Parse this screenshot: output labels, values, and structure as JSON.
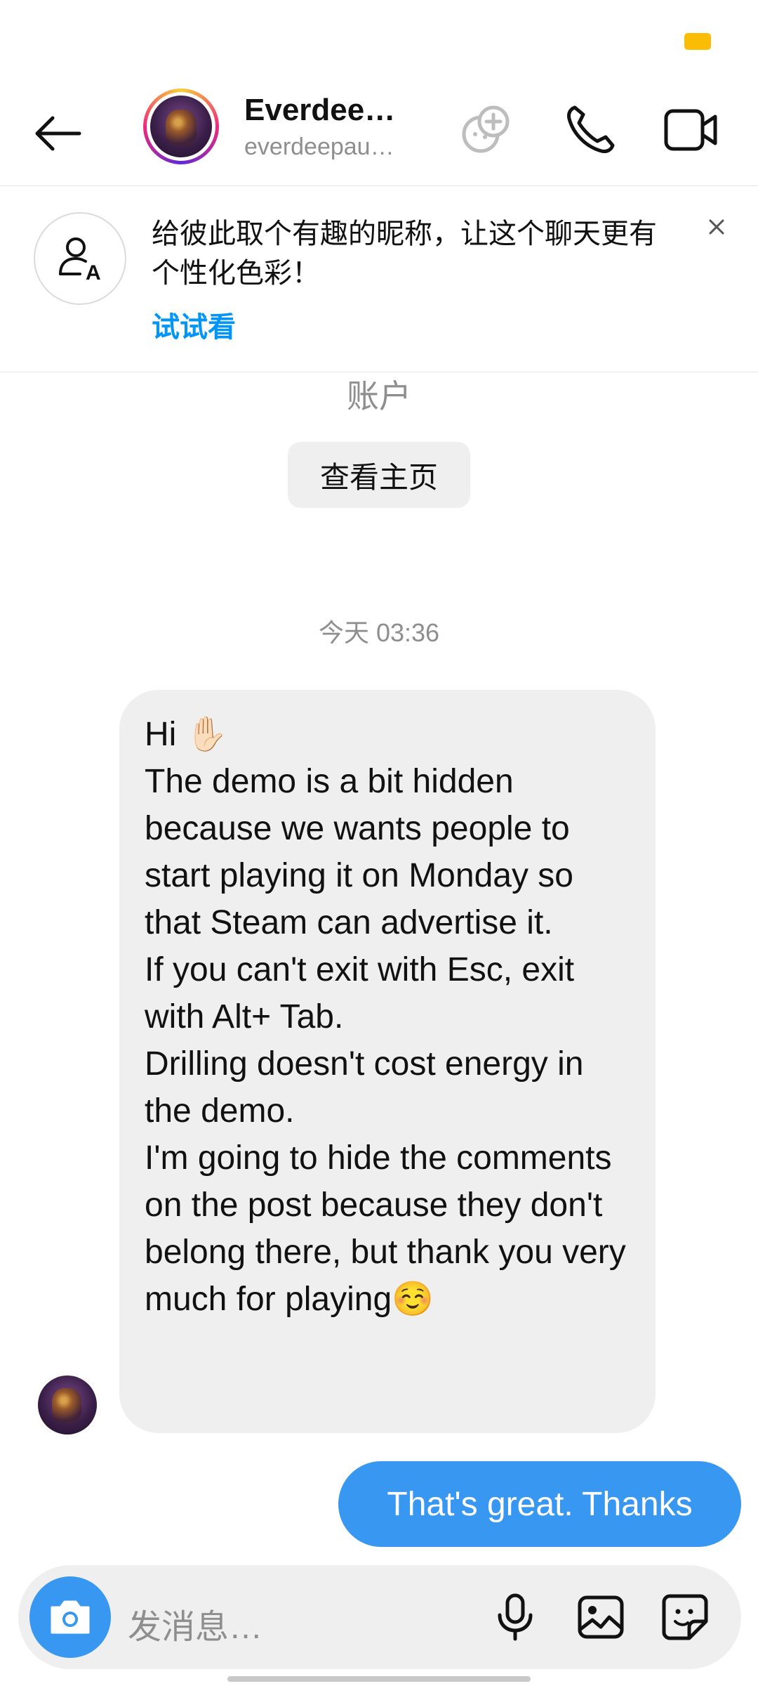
{
  "header": {
    "name": "Everdee…",
    "handle": "everdeepau…"
  },
  "banner": {
    "text": "给彼此取个有趣的昵称，让这个聊天更有个性化色彩！",
    "link": "试试看",
    "close": "×"
  },
  "profile": {
    "account_text": "账户",
    "view_profile_label": "查看主页"
  },
  "chat": {
    "timestamp": "今天 03:36",
    "incoming_message": "Hi ✋🏻\nThe demo is a bit hidden because we wants people to start playing it on Monday so that Steam can advertise it.\nIf you can't exit with Esc, exit with Alt+ Tab.\nDrilling doesn't cost energy in the demo.\nI'm going to hide the comments on the post because they don't belong there, but thank you very much for playing☺️",
    "outgoing_message": "That's great. Thanks"
  },
  "composer": {
    "placeholder": "发消息…"
  },
  "colors": {
    "accent": "#3897f0",
    "link": "#0095f6",
    "battery": "#fbbc05"
  }
}
